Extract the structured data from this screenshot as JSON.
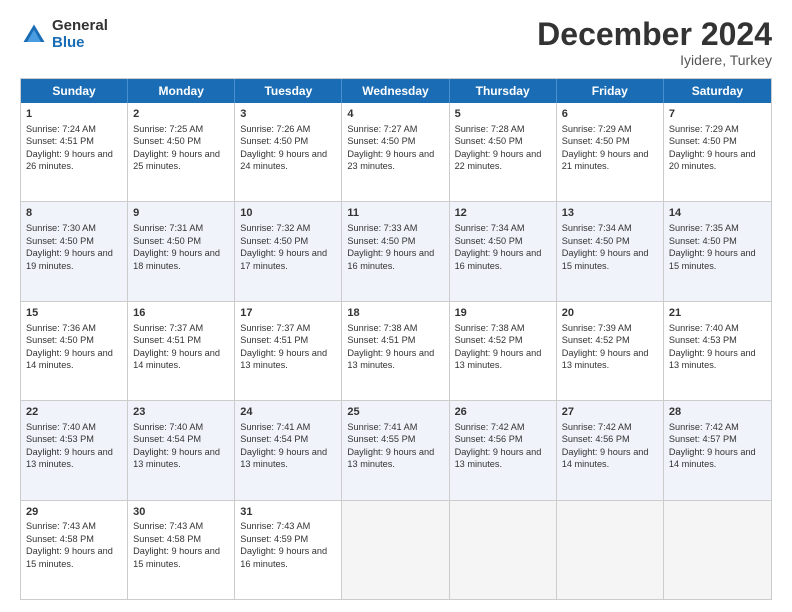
{
  "header": {
    "logo_general": "General",
    "logo_blue": "Blue",
    "month_title": "December 2024",
    "location": "Iyidere, Turkey"
  },
  "weekdays": [
    "Sunday",
    "Monday",
    "Tuesday",
    "Wednesday",
    "Thursday",
    "Friday",
    "Saturday"
  ],
  "weeks": [
    [
      {
        "day": "1",
        "sunrise": "Sunrise: 7:24 AM",
        "sunset": "Sunset: 4:51 PM",
        "daylight": "Daylight: 9 hours and 26 minutes."
      },
      {
        "day": "2",
        "sunrise": "Sunrise: 7:25 AM",
        "sunset": "Sunset: 4:50 PM",
        "daylight": "Daylight: 9 hours and 25 minutes."
      },
      {
        "day": "3",
        "sunrise": "Sunrise: 7:26 AM",
        "sunset": "Sunset: 4:50 PM",
        "daylight": "Daylight: 9 hours and 24 minutes."
      },
      {
        "day": "4",
        "sunrise": "Sunrise: 7:27 AM",
        "sunset": "Sunset: 4:50 PM",
        "daylight": "Daylight: 9 hours and 23 minutes."
      },
      {
        "day": "5",
        "sunrise": "Sunrise: 7:28 AM",
        "sunset": "Sunset: 4:50 PM",
        "daylight": "Daylight: 9 hours and 22 minutes."
      },
      {
        "day": "6",
        "sunrise": "Sunrise: 7:29 AM",
        "sunset": "Sunset: 4:50 PM",
        "daylight": "Daylight: 9 hours and 21 minutes."
      },
      {
        "day": "7",
        "sunrise": "Sunrise: 7:29 AM",
        "sunset": "Sunset: 4:50 PM",
        "daylight": "Daylight: 9 hours and 20 minutes."
      }
    ],
    [
      {
        "day": "8",
        "sunrise": "Sunrise: 7:30 AM",
        "sunset": "Sunset: 4:50 PM",
        "daylight": "Daylight: 9 hours and 19 minutes."
      },
      {
        "day": "9",
        "sunrise": "Sunrise: 7:31 AM",
        "sunset": "Sunset: 4:50 PM",
        "daylight": "Daylight: 9 hours and 18 minutes."
      },
      {
        "day": "10",
        "sunrise": "Sunrise: 7:32 AM",
        "sunset": "Sunset: 4:50 PM",
        "daylight": "Daylight: 9 hours and 17 minutes."
      },
      {
        "day": "11",
        "sunrise": "Sunrise: 7:33 AM",
        "sunset": "Sunset: 4:50 PM",
        "daylight": "Daylight: 9 hours and 16 minutes."
      },
      {
        "day": "12",
        "sunrise": "Sunrise: 7:34 AM",
        "sunset": "Sunset: 4:50 PM",
        "daylight": "Daylight: 9 hours and 16 minutes."
      },
      {
        "day": "13",
        "sunrise": "Sunrise: 7:34 AM",
        "sunset": "Sunset: 4:50 PM",
        "daylight": "Daylight: 9 hours and 15 minutes."
      },
      {
        "day": "14",
        "sunrise": "Sunrise: 7:35 AM",
        "sunset": "Sunset: 4:50 PM",
        "daylight": "Daylight: 9 hours and 15 minutes."
      }
    ],
    [
      {
        "day": "15",
        "sunrise": "Sunrise: 7:36 AM",
        "sunset": "Sunset: 4:50 PM",
        "daylight": "Daylight: 9 hours and 14 minutes."
      },
      {
        "day": "16",
        "sunrise": "Sunrise: 7:37 AM",
        "sunset": "Sunset: 4:51 PM",
        "daylight": "Daylight: 9 hours and 14 minutes."
      },
      {
        "day": "17",
        "sunrise": "Sunrise: 7:37 AM",
        "sunset": "Sunset: 4:51 PM",
        "daylight": "Daylight: 9 hours and 13 minutes."
      },
      {
        "day": "18",
        "sunrise": "Sunrise: 7:38 AM",
        "sunset": "Sunset: 4:51 PM",
        "daylight": "Daylight: 9 hours and 13 minutes."
      },
      {
        "day": "19",
        "sunrise": "Sunrise: 7:38 AM",
        "sunset": "Sunset: 4:52 PM",
        "daylight": "Daylight: 9 hours and 13 minutes."
      },
      {
        "day": "20",
        "sunrise": "Sunrise: 7:39 AM",
        "sunset": "Sunset: 4:52 PM",
        "daylight": "Daylight: 9 hours and 13 minutes."
      },
      {
        "day": "21",
        "sunrise": "Sunrise: 7:40 AM",
        "sunset": "Sunset: 4:53 PM",
        "daylight": "Daylight: 9 hours and 13 minutes."
      }
    ],
    [
      {
        "day": "22",
        "sunrise": "Sunrise: 7:40 AM",
        "sunset": "Sunset: 4:53 PM",
        "daylight": "Daylight: 9 hours and 13 minutes."
      },
      {
        "day": "23",
        "sunrise": "Sunrise: 7:40 AM",
        "sunset": "Sunset: 4:54 PM",
        "daylight": "Daylight: 9 hours and 13 minutes."
      },
      {
        "day": "24",
        "sunrise": "Sunrise: 7:41 AM",
        "sunset": "Sunset: 4:54 PM",
        "daylight": "Daylight: 9 hours and 13 minutes."
      },
      {
        "day": "25",
        "sunrise": "Sunrise: 7:41 AM",
        "sunset": "Sunset: 4:55 PM",
        "daylight": "Daylight: 9 hours and 13 minutes."
      },
      {
        "day": "26",
        "sunrise": "Sunrise: 7:42 AM",
        "sunset": "Sunset: 4:56 PM",
        "daylight": "Daylight: 9 hours and 13 minutes."
      },
      {
        "day": "27",
        "sunrise": "Sunrise: 7:42 AM",
        "sunset": "Sunset: 4:56 PM",
        "daylight": "Daylight: 9 hours and 14 minutes."
      },
      {
        "day": "28",
        "sunrise": "Sunrise: 7:42 AM",
        "sunset": "Sunset: 4:57 PM",
        "daylight": "Daylight: 9 hours and 14 minutes."
      }
    ],
    [
      {
        "day": "29",
        "sunrise": "Sunrise: 7:43 AM",
        "sunset": "Sunset: 4:58 PM",
        "daylight": "Daylight: 9 hours and 15 minutes."
      },
      {
        "day": "30",
        "sunrise": "Sunrise: 7:43 AM",
        "sunset": "Sunset: 4:58 PM",
        "daylight": "Daylight: 9 hours and 15 minutes."
      },
      {
        "day": "31",
        "sunrise": "Sunrise: 7:43 AM",
        "sunset": "Sunset: 4:59 PM",
        "daylight": "Daylight: 9 hours and 16 minutes."
      },
      null,
      null,
      null,
      null
    ]
  ]
}
